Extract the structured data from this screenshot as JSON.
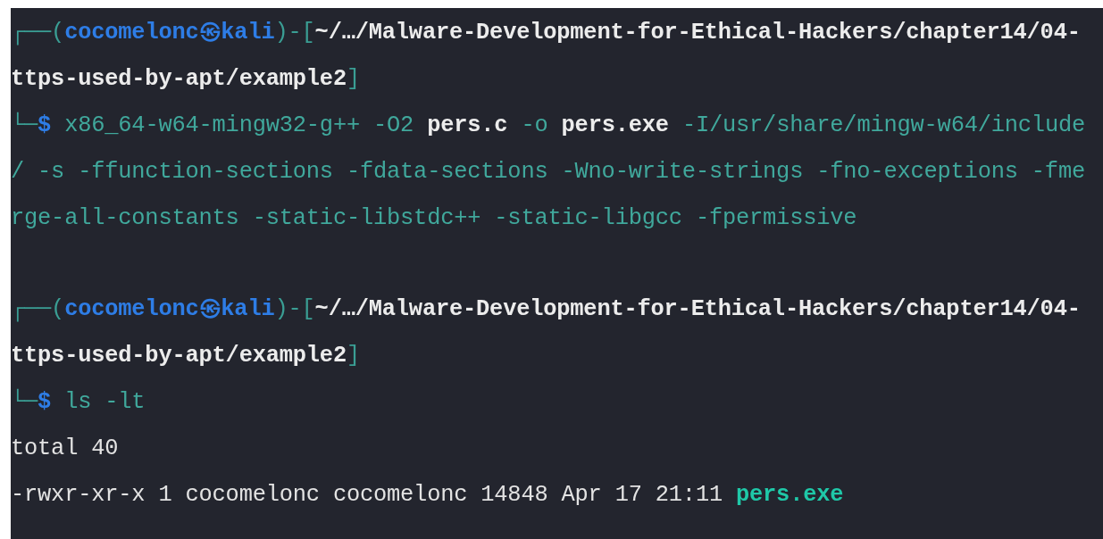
{
  "terminal": {
    "blocks": [
      {
        "rows": [
          {
            "segments": [
              {
                "kind": "frame",
                "text": "┌──("
              },
              {
                "kind": "user",
                "text": "cocomelonc㉿kali"
              },
              {
                "kind": "frame",
                "text": ")-["
              },
              {
                "kind": "path",
                "text": "~/…/Malware-Development-for-Ethical-Hackers/chapter14/04-"
              }
            ]
          },
          {
            "segments": [
              {
                "kind": "path",
                "text": "ttps-used-by-apt/example2"
              },
              {
                "kind": "frame",
                "text": "]"
              }
            ]
          },
          {
            "segments": [
              {
                "kind": "frame",
                "text": "└─"
              },
              {
                "kind": "user",
                "text": "$"
              },
              {
                "kind": "arg",
                "text": " x86_64-w64-mingw32-g++ -O2 "
              },
              {
                "kind": "path",
                "text": "pers.c"
              },
              {
                "kind": "arg",
                "text": " -o "
              },
              {
                "kind": "path",
                "text": "pers.exe"
              },
              {
                "kind": "arg",
                "text": " -I/usr/share/mingw-w64/include"
              }
            ]
          },
          {
            "segments": [
              {
                "kind": "arg",
                "text": "/ -s -ffunction-sections -fdata-sections -Wno-write-strings -fno-exceptions -fme"
              }
            ]
          },
          {
            "segments": [
              {
                "kind": "arg",
                "text": "rge-all-constants -static-libstdc++ -static-libgcc -fpermissive"
              }
            ]
          }
        ]
      },
      {
        "rows": [
          {
            "segments": [
              {
                "kind": "frame",
                "text": "┌──("
              },
              {
                "kind": "user",
                "text": "cocomelonc㉿kali"
              },
              {
                "kind": "frame",
                "text": ")-["
              },
              {
                "kind": "path",
                "text": "~/…/Malware-Development-for-Ethical-Hackers/chapter14/04-"
              }
            ]
          },
          {
            "segments": [
              {
                "kind": "path",
                "text": "ttps-used-by-apt/example2"
              },
              {
                "kind": "frame",
                "text": "]"
              }
            ]
          },
          {
            "segments": [
              {
                "kind": "frame",
                "text": "└─"
              },
              {
                "kind": "user",
                "text": "$"
              },
              {
                "kind": "arg",
                "text": " ls -lt"
              }
            ]
          },
          {
            "segments": [
              {
                "kind": "output",
                "text": "total 40"
              }
            ]
          },
          {
            "segments": [
              {
                "kind": "output",
                "text": "-rwxr-xr-x 1 cocomelonc cocomelonc 14848 Apr 17 21:11 "
              },
              {
                "kind": "exe",
                "text": "pers.exe"
              }
            ]
          }
        ]
      }
    ]
  }
}
